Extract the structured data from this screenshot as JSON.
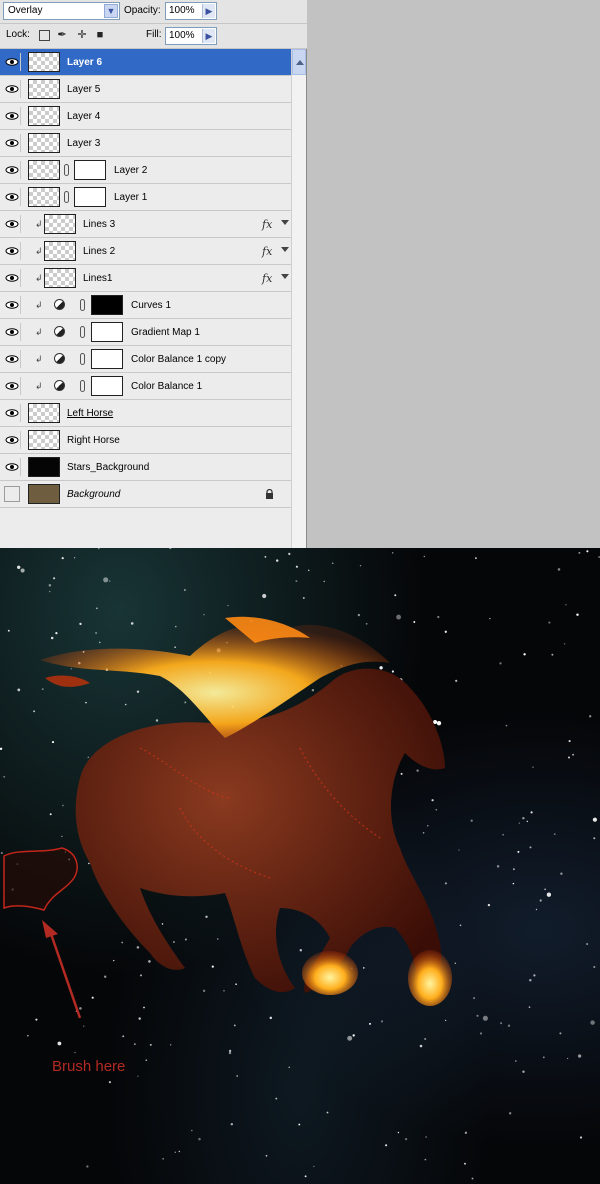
{
  "blend_mode": {
    "value": "Overlay"
  },
  "opacity": {
    "label": "Opacity:",
    "value": "100%"
  },
  "lock": {
    "label": "Lock:"
  },
  "fill": {
    "label": "Fill:",
    "value": "100%"
  },
  "layers": [
    {
      "name": "Layer 6",
      "selected": true
    },
    {
      "name": "Layer 5"
    },
    {
      "name": "Layer 4"
    },
    {
      "name": "Layer 3"
    },
    {
      "name": "Layer 2"
    },
    {
      "name": "Layer 1"
    },
    {
      "name": "Lines 3",
      "fx": "fx"
    },
    {
      "name": "Lines 2",
      "fx": "fx"
    },
    {
      "name": "Lines1",
      "fx": "fx"
    },
    {
      "name": "Curves 1"
    },
    {
      "name": "Gradient Map 1"
    },
    {
      "name": "Color Balance 1 copy"
    },
    {
      "name": "Color Balance 1"
    },
    {
      "name": "Left Horse"
    },
    {
      "name": "Right Horse"
    },
    {
      "name": "Stars_Background"
    },
    {
      "name": "Background"
    }
  ],
  "annotation": {
    "text": "Brush here",
    "color": "#b22a22"
  },
  "colors": {
    "selection": "#3169c6",
    "panel": "#ececec",
    "fire": "#ff9a1a",
    "horse": "#7a2a16"
  }
}
